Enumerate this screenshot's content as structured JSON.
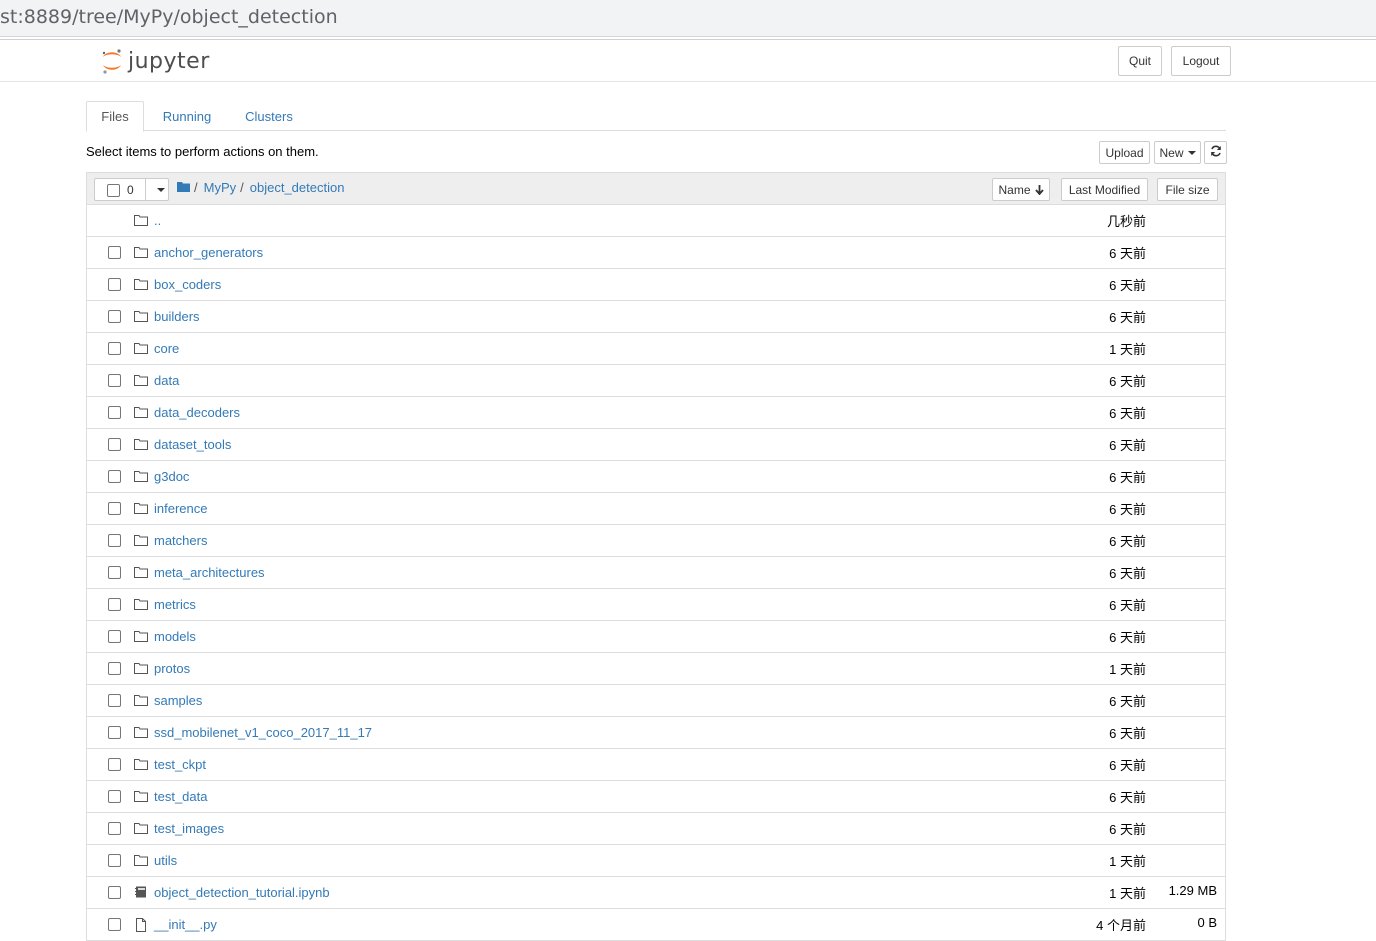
{
  "browser": {
    "url": "st:8889/tree/MyPy/object_detection"
  },
  "header": {
    "logo_text": "jupyter",
    "quit_label": "Quit",
    "logout_label": "Logout"
  },
  "tabs": [
    {
      "label": "Files",
      "active": true
    },
    {
      "label": "Running",
      "active": false
    },
    {
      "label": "Clusters",
      "active": false
    }
  ],
  "toolbar": {
    "hint": "Select items to perform actions on them.",
    "upload_label": "Upload",
    "new_label": "New",
    "refresh_icon": "refresh-icon"
  },
  "list_header": {
    "selected_count": "0",
    "breadcrumb": [
      "MyPy",
      "object_detection"
    ],
    "sort_name_label": "Name",
    "last_modified_label": "Last Modified",
    "file_size_label": "File size"
  },
  "colors": {
    "link": "#337ab7",
    "logo_orange": "#f37726"
  },
  "items": [
    {
      "name": "..",
      "type": "parent",
      "modified": "几秒前",
      "size": ""
    },
    {
      "name": "anchor_generators",
      "type": "folder",
      "modified": "6 天前",
      "size": ""
    },
    {
      "name": "box_coders",
      "type": "folder",
      "modified": "6 天前",
      "size": ""
    },
    {
      "name": "builders",
      "type": "folder",
      "modified": "6 天前",
      "size": ""
    },
    {
      "name": "core",
      "type": "folder",
      "modified": "1 天前",
      "size": ""
    },
    {
      "name": "data",
      "type": "folder",
      "modified": "6 天前",
      "size": ""
    },
    {
      "name": "data_decoders",
      "type": "folder",
      "modified": "6 天前",
      "size": ""
    },
    {
      "name": "dataset_tools",
      "type": "folder",
      "modified": "6 天前",
      "size": ""
    },
    {
      "name": "g3doc",
      "type": "folder",
      "modified": "6 天前",
      "size": ""
    },
    {
      "name": "inference",
      "type": "folder",
      "modified": "6 天前",
      "size": ""
    },
    {
      "name": "matchers",
      "type": "folder",
      "modified": "6 天前",
      "size": ""
    },
    {
      "name": "meta_architectures",
      "type": "folder",
      "modified": "6 天前",
      "size": ""
    },
    {
      "name": "metrics",
      "type": "folder",
      "modified": "6 天前",
      "size": ""
    },
    {
      "name": "models",
      "type": "folder",
      "modified": "6 天前",
      "size": ""
    },
    {
      "name": "protos",
      "type": "folder",
      "modified": "1 天前",
      "size": ""
    },
    {
      "name": "samples",
      "type": "folder",
      "modified": "6 天前",
      "size": ""
    },
    {
      "name": "ssd_mobilenet_v1_coco_2017_11_17",
      "type": "folder",
      "modified": "6 天前",
      "size": ""
    },
    {
      "name": "test_ckpt",
      "type": "folder",
      "modified": "6 天前",
      "size": ""
    },
    {
      "name": "test_data",
      "type": "folder",
      "modified": "6 天前",
      "size": ""
    },
    {
      "name": "test_images",
      "type": "folder",
      "modified": "6 天前",
      "size": ""
    },
    {
      "name": "utils",
      "type": "folder",
      "modified": "1 天前",
      "size": ""
    },
    {
      "name": "object_detection_tutorial.ipynb",
      "type": "notebook",
      "modified": "1 天前",
      "size": "1.29 MB"
    },
    {
      "name": "__init__.py",
      "type": "file",
      "modified": "4 个月前",
      "size": "0 B"
    }
  ]
}
